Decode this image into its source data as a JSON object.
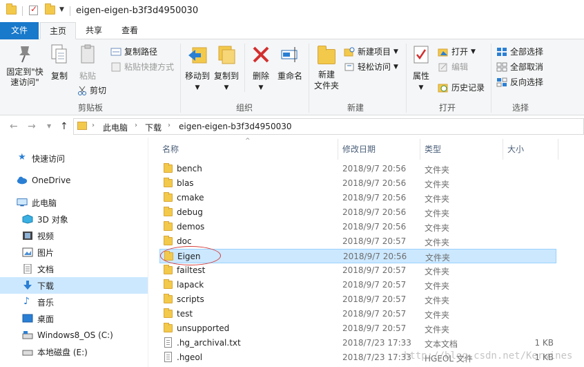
{
  "window": {
    "title": "eigen-eigen-b3f3d4950030"
  },
  "ribbon_tabs": {
    "file": "文件",
    "home": "主页",
    "share": "共享",
    "view": "查看"
  },
  "ribbon": {
    "clipboard": {
      "pin_label_1": "固定到\"快",
      "pin_label_2": "速访问\"",
      "copy": "复制",
      "paste": "粘贴",
      "copy_path": "复制路径",
      "paste_shortcut": "粘贴快捷方式",
      "cut": "剪切",
      "group": "剪贴板"
    },
    "organize": {
      "move_to": "移动到",
      "copy_to": "复制到",
      "delete": "删除",
      "rename": "重命名",
      "group": "组织"
    },
    "new": {
      "new_folder_1": "新建",
      "new_folder_2": "文件夹",
      "new_item": "新建项目",
      "easy_access": "轻松访问",
      "group": "新建"
    },
    "open": {
      "properties": "属性",
      "open": "打开",
      "edit": "编辑",
      "history": "历史记录",
      "group": "打开"
    },
    "select": {
      "select_all": "全部选择",
      "select_none": "全部取消",
      "invert": "反向选择",
      "group": "选择"
    }
  },
  "address": {
    "crumbs": [
      "此电脑",
      "下载",
      "eigen-eigen-b3f3d4950030"
    ]
  },
  "nav": {
    "items": [
      {
        "label": "快速访问",
        "icon": "star-icon"
      },
      {
        "label": "OneDrive",
        "icon": "cloud-icon"
      },
      {
        "label": "此电脑",
        "icon": "computer-icon"
      },
      {
        "label": "3D 对象",
        "icon": "cube-icon"
      },
      {
        "label": "视频",
        "icon": "video-icon"
      },
      {
        "label": "图片",
        "icon": "picture-icon"
      },
      {
        "label": "文档",
        "icon": "document-icon"
      },
      {
        "label": "下载",
        "icon": "download-icon"
      },
      {
        "label": "音乐",
        "icon": "music-icon"
      },
      {
        "label": "桌面",
        "icon": "desktop-icon"
      },
      {
        "label": "Windows8_OS (C:)",
        "icon": "drive-icon"
      },
      {
        "label": "本地磁盘 (E:)",
        "icon": "drive-icon"
      }
    ]
  },
  "list": {
    "headers": {
      "name": "名称",
      "date": "修改日期",
      "type": "类型",
      "size": "大小"
    },
    "rows": [
      {
        "name": "bench",
        "date": "2018/9/7 20:56",
        "type": "文件夹",
        "size": ""
      },
      {
        "name": "blas",
        "date": "2018/9/7 20:56",
        "type": "文件夹",
        "size": ""
      },
      {
        "name": "cmake",
        "date": "2018/9/7 20:56",
        "type": "文件夹",
        "size": ""
      },
      {
        "name": "debug",
        "date": "2018/9/7 20:56",
        "type": "文件夹",
        "size": ""
      },
      {
        "name": "demos",
        "date": "2018/9/7 20:56",
        "type": "文件夹",
        "size": ""
      },
      {
        "name": "doc",
        "date": "2018/9/7 20:57",
        "type": "文件夹",
        "size": ""
      },
      {
        "name": "Eigen",
        "date": "2018/9/7 20:56",
        "type": "文件夹",
        "size": ""
      },
      {
        "name": "failtest",
        "date": "2018/9/7 20:57",
        "type": "文件夹",
        "size": ""
      },
      {
        "name": "lapack",
        "date": "2018/9/7 20:57",
        "type": "文件夹",
        "size": ""
      },
      {
        "name": "scripts",
        "date": "2018/9/7 20:57",
        "type": "文件夹",
        "size": ""
      },
      {
        "name": "test",
        "date": "2018/9/7 20:57",
        "type": "文件夹",
        "size": ""
      },
      {
        "name": "unsupported",
        "date": "2018/9/7 20:57",
        "type": "文件夹",
        "size": ""
      },
      {
        "name": ".hg_archival.txt",
        "date": "2018/7/23 17:33",
        "type": "文本文档",
        "size": "1 KB"
      },
      {
        "name": ".hgeol",
        "date": "2018/7/23 17:33",
        "type": "HGEOL 文件",
        "size": "1 KB"
      }
    ],
    "selected_index": 6
  },
  "watermark": "http://blog.csdn.net/Kerwines",
  "colors": {
    "accent": "#1979ca",
    "selection": "#cce8ff",
    "folder": "#f3c94b",
    "annotation": "#d43b3b"
  }
}
